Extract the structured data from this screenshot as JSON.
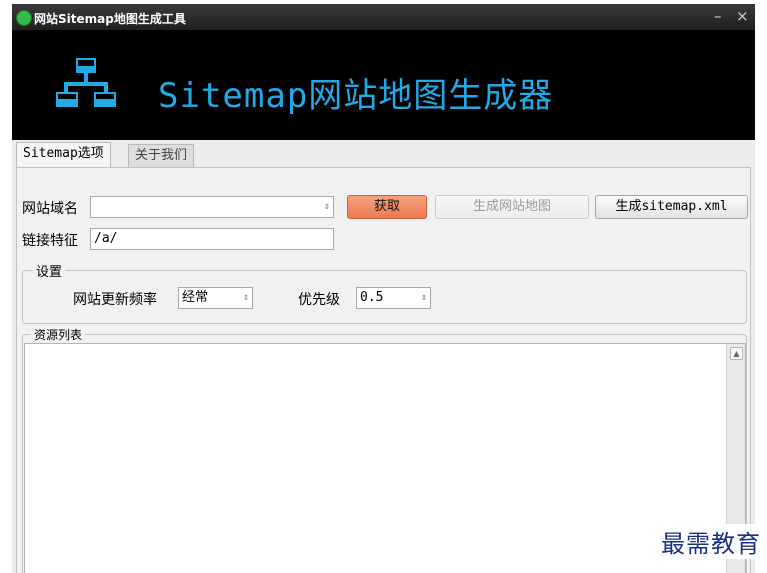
{
  "window": {
    "title": "网站Sitemap地图生成工具",
    "minimize": "–",
    "close": "×"
  },
  "banner": {
    "heading": "Sitemap网站地图生成器",
    "logo_icon": "sitemap-icon",
    "accent": "#22a9e6"
  },
  "tabs": [
    {
      "label": "Sitemap选项",
      "active": true
    },
    {
      "label": "关于我们",
      "active": false
    }
  ],
  "form": {
    "domain_label": "网站域名",
    "domain_value": "",
    "link_label": "链接特征",
    "link_value": "/a/",
    "fetch_button": "获取",
    "generate_button": "生成网站地图",
    "generate_xml_button": "生成sitemap.xml"
  },
  "settings": {
    "title": "设置",
    "freq_label": "网站更新频率",
    "freq_value": "经常",
    "priority_label": "优先级",
    "priority_value": "0.5"
  },
  "resources": {
    "title": "资源列表"
  },
  "watermark": "最需教育"
}
